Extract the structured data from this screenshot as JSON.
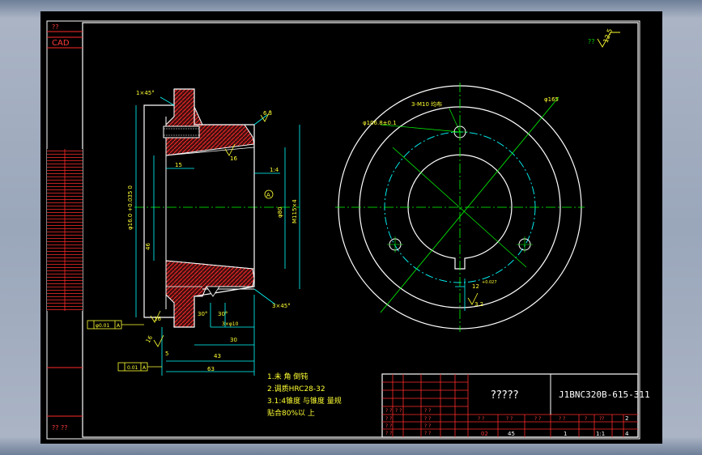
{
  "sidebar": {
    "top_label": "??",
    "logo": "CAD",
    "bottom_label": "?? ??"
  },
  "roughness": {
    "prefix": "??",
    "value": "12.5"
  },
  "section_view": {
    "chamfer_top": "1×45°",
    "surface_top": "6.3",
    "diameter_bore": "φ16.0 +0.035 0",
    "diameter_80": "φ80",
    "thread_m115": "M115×4",
    "dim_46": "46",
    "dim_15": "15",
    "dim_16_a": "16",
    "dim_16_b": "16",
    "dim_16_c": "16",
    "taper_label": "1:4",
    "datum_a": "A",
    "angle_left": "30°",
    "angle_right": "30°",
    "holes_label": "3×φ10",
    "dim_30": "30",
    "dim_43": "43",
    "dim_5": "5",
    "dim_63": "63",
    "chamfer_bottom": "3×45°",
    "tolerance_1": "φ0.01",
    "tolerance_1_datum": "A",
    "tolerance_2": "0.01",
    "tolerance_2_datum": "A"
  },
  "front_view": {
    "pcd_label": "φ106.8±0.1",
    "holes_label": "3-M10 均布",
    "outer_label": "φ165",
    "key_width": "12",
    "key_tol": "+0.027",
    "key_depth": "3.2"
  },
  "notes": [
    "1.未 角 倒钝",
    "2.调质HRC28-32",
    "3.1:4锥度 与锥度 量规",
    "贴合80%以 上"
  ],
  "title_block": {
    "name": "?????",
    "drawing_number": "J1BNC320B-615-311",
    "material": "45",
    "scale": "1:1",
    "quantity": "1",
    "sheet": "4",
    "sheets_total": "2",
    "code": "02",
    "small_labels": [
      "? ?",
      "? ?",
      "? ?",
      "? ?",
      "? ?",
      "? ?",
      "? ?",
      "? ?",
      "? ?",
      "?",
      "??",
      "? ?",
      "? ?",
      "? ?",
      "? ?"
    ]
  }
}
